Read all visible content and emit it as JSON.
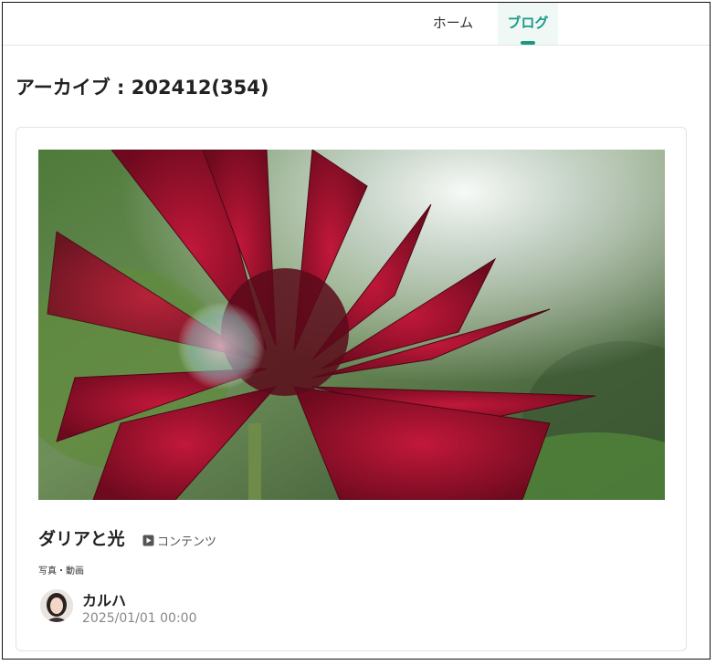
{
  "nav": {
    "tabs": [
      {
        "label": "ホーム",
        "active": false
      },
      {
        "label": "ブログ",
        "active": true
      }
    ],
    "accent_color": "#1a9a85"
  },
  "archive": {
    "title": "アーカイブ : 202412(354)"
  },
  "post": {
    "title": "ダリアと光",
    "type_icon": "video-icon",
    "type_label": "コンテンツ",
    "category": "写真・動画",
    "author": "カルハ",
    "date": "2025/01/01 00:00"
  }
}
